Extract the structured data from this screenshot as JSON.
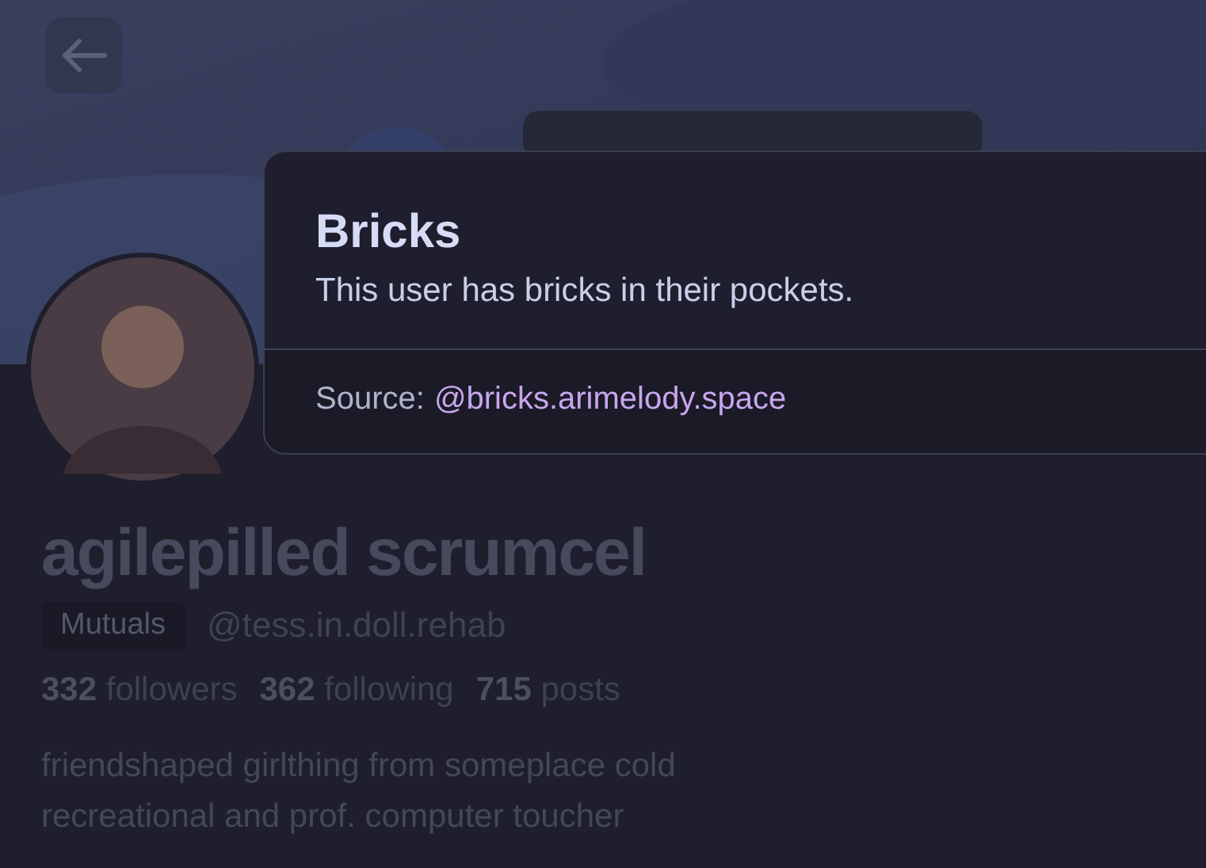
{
  "profile": {
    "display_name": "agilepilled scrumcel",
    "badge": "Mutuals",
    "handle": "@tess.in.doll.rehab",
    "stats": [
      "**332** followers",
      "**362** following",
      "**715** posts"
    ],
    "bio": [
      "friendshaped girlthing from someplace cold",
      "recreational and prof. computer toucher"
    ]
  },
  "label_popover": {
    "title": "Bricks",
    "description": "This user has bricks in their pockets.",
    "source_label": "Source:",
    "source_link": "@bricks.arimelody.space"
  }
}
